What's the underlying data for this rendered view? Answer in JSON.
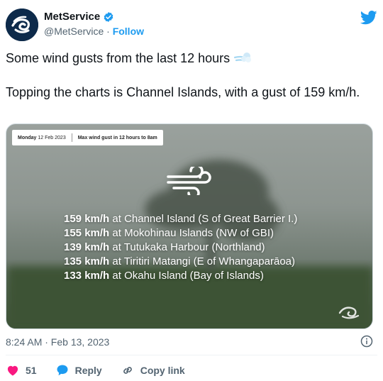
{
  "account": {
    "display_name": "MetService",
    "handle": "@MetService",
    "separator": "·",
    "follow_label": "Follow",
    "verified": true
  },
  "tweet": {
    "line1": "Some wind gusts from the last 12 hours",
    "line2": "Topping the charts is Channel Islands, with a gust of 159 km/h.",
    "emoji": "dash-symbol-icon"
  },
  "media": {
    "caption_day": "Monday",
    "caption_date": "12 Feb 2023",
    "caption_desc": "Max wind gust in 12 hours to 8am",
    "gusts": [
      {
        "value": "159 km/h",
        "location": "at Channel Island (S of Great Barrier I.)"
      },
      {
        "value": "155 km/h",
        "location": "at Mokohinau Islands (NW of GBI)"
      },
      {
        "value": "139 km/h",
        "location": "at Tutukaka Harbour (Northland)"
      },
      {
        "value": "135 km/h",
        "location": "at Tiritiri Matangi (E of Whangaparāoa)"
      },
      {
        "value": "133 km/h",
        "location": "at Okahu Island (Bay of Islands)"
      }
    ]
  },
  "meta": {
    "timestamp": "8:24 AM · Feb 13, 2023"
  },
  "actions": {
    "like_count": "51",
    "reply_label": "Reply",
    "copy_link_label": "Copy link"
  },
  "colors": {
    "accent": "#1d9bf0",
    "like": "#f91880",
    "text": "#0f1419",
    "muted": "#536471"
  }
}
